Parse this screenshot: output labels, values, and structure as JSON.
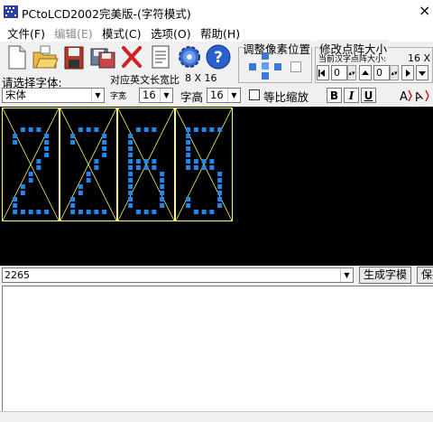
{
  "window": {
    "title": "PCtoLCD2002完美版-(字符模式)",
    "close_glyph": "×"
  },
  "menu": [
    {
      "label": "文件(F)",
      "disabled": false
    },
    {
      "label": "编辑(E)",
      "disabled": true
    },
    {
      "label": "模式(C)",
      "disabled": false
    },
    {
      "label": "选项(O)",
      "disabled": false
    },
    {
      "label": "帮助(H)",
      "disabled": false
    }
  ],
  "toolbar": {
    "buttons": [
      "new-file-icon",
      "open-folder-icon",
      "save-disk-icon",
      "save-as-icon",
      "delete-icon",
      "notepad-icon",
      "settings-gear-icon",
      "help-icon"
    ],
    "font_label": "请选择字体:",
    "font_value": "宋体",
    "en_width_label": "对应英文长宽比",
    "en_width_value": "8 X 16",
    "char_width_label": "字宽",
    "char_width_value": "16",
    "char_height_label": "字高",
    "char_height_value": "16",
    "proportional_label": "等比缩放",
    "bold_label": "B",
    "italic_label": "I",
    "underline_label": "U",
    "pixel_adjust_title": "调整像素位置",
    "dot_matrix_title": "修改点阵大小",
    "current_size_label": "当前汉字点阵大小:",
    "current_size_value": "16 X",
    "spin1_value": "0",
    "spin2_value": "0"
  },
  "canvas": {
    "text": "2265",
    "grid_color": "#ffff66",
    "dot_color": "#1e88f0",
    "background": "#000000"
  },
  "input": {
    "value": "2265",
    "generate_button": "生成字模",
    "save_button": "保存"
  }
}
